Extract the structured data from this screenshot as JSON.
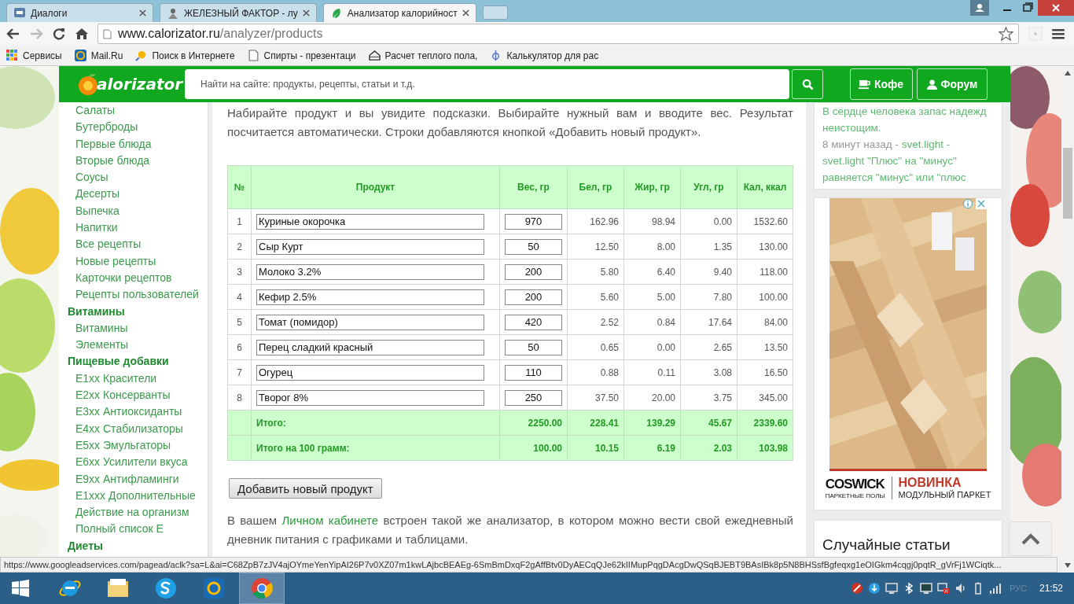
{
  "browser": {
    "tabs": [
      {
        "title": "Диалоги",
        "kind": "chat",
        "selected": false
      },
      {
        "title": "ЖЕЛЕЗНЫЙ ФАКТОР - лу",
        "kind": "emblem",
        "selected": false
      },
      {
        "title": "Анализатор калорийност",
        "kind": "leaf",
        "selected": true
      }
    ],
    "address": {
      "host": "www.calorizator.ru",
      "path": "/analyzer/products"
    },
    "bookmarks": [
      {
        "title": "Сервисы",
        "kind": "apps"
      },
      {
        "title": "Mail.Ru",
        "kind": "mail"
      },
      {
        "title": "Поиск в Интернете",
        "kind": "search"
      },
      {
        "title": "Спирты - презентаци",
        "kind": "page"
      },
      {
        "title": "Расчет теплого пола,",
        "kind": "house"
      },
      {
        "title": "Калькулятор для рас",
        "kind": "phi"
      }
    ]
  },
  "header": {
    "logo": "alorizator",
    "search_placeholder": "Найти на сайте: продукты, рецепты, статьи и т.д.",
    "buttons": [
      {
        "label": "Кофе",
        "kind": "cup"
      },
      {
        "label": "Форум",
        "kind": "user"
      }
    ]
  },
  "sidebar": {
    "items": [
      {
        "label": "Салаты",
        "kind": "link"
      },
      {
        "label": "Бутерброды",
        "kind": "link"
      },
      {
        "label": "Первые блюда",
        "kind": "link"
      },
      {
        "label": "Вторые блюда",
        "kind": "link"
      },
      {
        "label": "Соусы",
        "kind": "link"
      },
      {
        "label": "Десерты",
        "kind": "link"
      },
      {
        "label": "Выпечка",
        "kind": "link"
      },
      {
        "label": "Напитки",
        "kind": "link"
      },
      {
        "label": "Все рецепты",
        "kind": "link"
      },
      {
        "label": "Новые рецепты",
        "kind": "link"
      },
      {
        "label": "Карточки рецептов",
        "kind": "link"
      },
      {
        "label": "Рецепты пользователей",
        "kind": "link"
      },
      {
        "label": "Витамины",
        "kind": "heading"
      },
      {
        "label": "Витамины",
        "kind": "link"
      },
      {
        "label": "Элементы",
        "kind": "link"
      },
      {
        "label": "Пищевые добавки",
        "kind": "heading"
      },
      {
        "label": "E1xx Красители",
        "kind": "link"
      },
      {
        "label": "E2xx Консерванты",
        "kind": "link"
      },
      {
        "label": "E3xx Антиоксиданты",
        "kind": "link"
      },
      {
        "label": "E4xx Стабилизаторы",
        "kind": "link"
      },
      {
        "label": "E5xx Эмульгаторы",
        "kind": "link"
      },
      {
        "label": "E6xx Усилители вкуса",
        "kind": "link"
      },
      {
        "label": "E9xx Антифламинги",
        "kind": "link"
      },
      {
        "label": "E1xxx Дополнительные",
        "kind": "link"
      },
      {
        "label": "Действие на организм",
        "kind": "link"
      },
      {
        "label": "Полный список Е",
        "kind": "link"
      },
      {
        "label": "Диеты",
        "kind": "heading"
      }
    ]
  },
  "content": {
    "intro": "Набирайте продукт и вы увидите подсказки. Выбирайте нужный вам и вводите вес. Результат посчитается автоматически. Строки добавляются кнопкой «Добавить новый продукт».",
    "table": {
      "columns": [
        "№",
        "Продукт",
        "Вес, гр",
        "Бел, гр",
        "Жир, гр",
        "Угл, гр",
        "Кал, ккал"
      ],
      "rows": [
        {
          "n": "1",
          "product": "Куриные окорочка",
          "weight": "970",
          "protein": "162.96",
          "fat": "98.94",
          "carbs": "0.00",
          "kcal": "1532.60"
        },
        {
          "n": "2",
          "product": "Сыр Курт",
          "weight": "50",
          "protein": "12.50",
          "fat": "8.00",
          "carbs": "1.35",
          "kcal": "130.00"
        },
        {
          "n": "3",
          "product": "Молоко 3.2%",
          "weight": "200",
          "protein": "5.80",
          "fat": "6.40",
          "carbs": "9.40",
          "kcal": "118.00"
        },
        {
          "n": "4",
          "product": "Кефир 2.5%",
          "weight": "200",
          "protein": "5.60",
          "fat": "5.00",
          "carbs": "7.80",
          "kcal": "100.00"
        },
        {
          "n": "5",
          "product": "Томат (помидор)",
          "weight": "420",
          "protein": "2.52",
          "fat": "0.84",
          "carbs": "17.64",
          "kcal": "84.00"
        },
        {
          "n": "6",
          "product": "Перец сладкий красный",
          "weight": "50",
          "protein": "0.65",
          "fat": "0.00",
          "carbs": "2.65",
          "kcal": "13.50"
        },
        {
          "n": "7",
          "product": "Огурец",
          "weight": "110",
          "protein": "0.88",
          "fat": "0.11",
          "carbs": "3.08",
          "kcal": "16.50"
        },
        {
          "n": "8",
          "product": "Творог 8%",
          "weight": "250",
          "protein": "37.50",
          "fat": "20.00",
          "carbs": "3.75",
          "kcal": "345.00"
        }
      ],
      "totals": [
        {
          "label": "Итого:",
          "weight": "2250.00",
          "protein": "228.41",
          "fat": "139.29",
          "carbs": "45.67",
          "kcal": "2339.60"
        },
        {
          "label": "Итого на 100 грамм:",
          "weight": "100.00",
          "protein": "10.15",
          "fat": "6.19",
          "carbs": "2.03",
          "kcal": "103.98"
        }
      ]
    },
    "add_button": "Добавить новый продукт",
    "footer_before": "В вашем",
    "footer_link": "Личном кабинете",
    "footer_after": "встроен такой же анализатор, в котором можно вести свой ежедневный дневник питания с графиками и таблицами."
  },
  "right": {
    "comment_quote": "В сердце человека запас надежд неистощим.",
    "comment_meta": "8 минут назад -",
    "comment_user": "svet.light -",
    "comment_text": "svet.light \"Плюс\" на \"минус\" равняется \"минус\" или \"плюс",
    "ad": {
      "brand": "COSWICK",
      "brand_sub": "ПАРКЕТНЫЕ ПОЛЫ",
      "headline": "НОВИНКА",
      "subline": "МОДУЛЬНЫЙ ПАРКЕТ"
    },
    "random_title": "Случайные статьи"
  },
  "status_url": "https://www.googleadservices.com/pagead/aclk?sa=L&ai=C68ZpB7zJV4ajOYmeYenYipAI26P7v0XZ07m1kwLAjbcBEAEg-6SmBmDxqF2gAffBtv0DyAECqQJe62kIIMupPqgDAcgDwQSqBJEBT9BAsIBk8p5N8BHSsfBgfeqxg1eOIGkm4cqgj0pqtR_gVrFj1WCiqtk...",
  "taskbar": {
    "apps": [
      {
        "kind": "ie",
        "selected": false
      },
      {
        "kind": "folder",
        "selected": false
      },
      {
        "kind": "skype",
        "selected": false
      },
      {
        "kind": "mail",
        "selected": false
      },
      {
        "kind": "chrome",
        "selected": true
      }
    ],
    "language": "РУС",
    "clock": "21:52"
  }
}
